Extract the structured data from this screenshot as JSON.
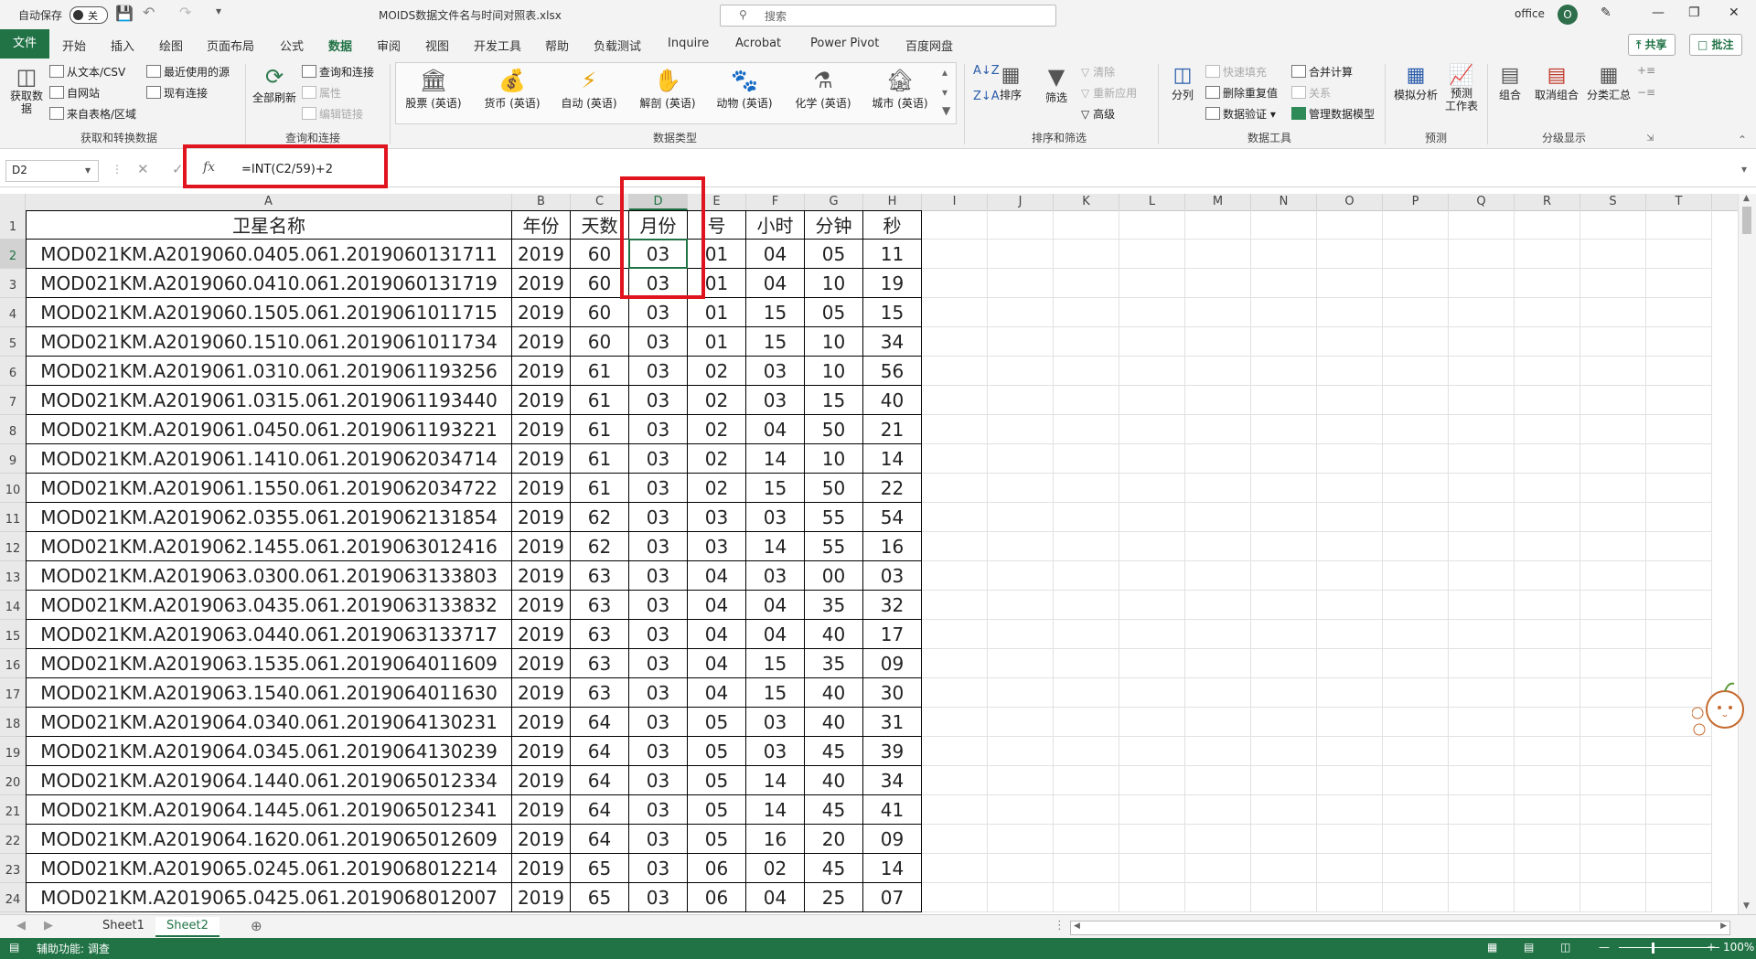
{
  "titlebar": {
    "autosave_label": "自动保存",
    "autosave_state": "关",
    "file_title": "MOIDS数据文件名与时间对照表.xlsx",
    "search_placeholder": "搜索",
    "user_name": "office",
    "avatar_initial": "O"
  },
  "tabs": [
    "文件",
    "开始",
    "插入",
    "绘图",
    "页面布局",
    "公式",
    "数据",
    "审阅",
    "视图",
    "开发工具",
    "帮助",
    "负载测试",
    "Inquire",
    "Acrobat",
    "Power Pivot",
    "百度网盘"
  ],
  "active_tab": "数据",
  "share_label": "共享",
  "comment_label": "批注",
  "ribbon": {
    "get_data": "获取数\n据",
    "from_text_csv": "从文本/CSV",
    "from_web": "自网站",
    "from_table": "来自表格/区域",
    "recent_sources": "最近使用的源",
    "existing_connections": "现有连接",
    "group_get_transform": "获取和转换数据",
    "refresh_all": "全部刷新",
    "queries_connections": "查询和连接",
    "properties": "属性",
    "edit_links": "编辑链接",
    "group_queries": "查询和连接",
    "data_types": [
      "股票 (英语)",
      "货币 (英语)",
      "自动 (英语)",
      "解剖 (英语)",
      "动物 (英语)",
      "化学 (英语)",
      "城市 (英语)"
    ],
    "group_data_types": "数据类型",
    "sort": "排序",
    "filter": "筛选",
    "clear": "清除",
    "reapply": "重新应用",
    "advanced": "高级",
    "group_sort_filter": "排序和筛选",
    "text_to_columns": "分列",
    "flash_fill": "快速填充",
    "remove_duplicates": "删除重复值",
    "data_validation": "数据验证",
    "consolidate": "合并计算",
    "relationships": "关系",
    "manage_model": "管理数据模型",
    "group_data_tools": "数据工具",
    "what_if": "模拟分析",
    "forecast_sheet": "预测\n工作表",
    "group_forecast": "预测",
    "group": "组合",
    "ungroup": "取消组合",
    "subtotal": "分类汇总",
    "group_outline": "分级显示"
  },
  "formula_bar": {
    "name_box": "D2",
    "formula": "=INT(C2/59)+2"
  },
  "columns": [
    "A",
    "B",
    "C",
    "D",
    "E",
    "F",
    "G",
    "H",
    "I",
    "J",
    "K",
    "L",
    "M",
    "N",
    "O",
    "P",
    "Q",
    "R",
    "S",
    "T"
  ],
  "selected_column": "D",
  "selected_row": "2",
  "headers": [
    "卫星名称",
    "年份",
    "天数",
    "月份",
    "号",
    "小时",
    "分钟",
    "秒"
  ],
  "rows": [
    [
      "MOD021KM.A2019060.0405.061.2019060131711",
      "2019",
      "60",
      "03",
      "01",
      "04",
      "05",
      "11"
    ],
    [
      "MOD021KM.A2019060.0410.061.2019060131719",
      "2019",
      "60",
      "03",
      "01",
      "04",
      "10",
      "19"
    ],
    [
      "MOD021KM.A2019060.1505.061.2019061011715",
      "2019",
      "60",
      "03",
      "01",
      "15",
      "05",
      "15"
    ],
    [
      "MOD021KM.A2019060.1510.061.2019061011734",
      "2019",
      "60",
      "03",
      "01",
      "15",
      "10",
      "34"
    ],
    [
      "MOD021KM.A2019061.0310.061.2019061193256",
      "2019",
      "61",
      "03",
      "02",
      "03",
      "10",
      "56"
    ],
    [
      "MOD021KM.A2019061.0315.061.2019061193440",
      "2019",
      "61",
      "03",
      "02",
      "03",
      "15",
      "40"
    ],
    [
      "MOD021KM.A2019061.0450.061.2019061193221",
      "2019",
      "61",
      "03",
      "02",
      "04",
      "50",
      "21"
    ],
    [
      "MOD021KM.A2019061.1410.061.2019062034714",
      "2019",
      "61",
      "03",
      "02",
      "14",
      "10",
      "14"
    ],
    [
      "MOD021KM.A2019061.1550.061.2019062034722",
      "2019",
      "61",
      "03",
      "02",
      "15",
      "50",
      "22"
    ],
    [
      "MOD021KM.A2019062.0355.061.2019062131854",
      "2019",
      "62",
      "03",
      "03",
      "03",
      "55",
      "54"
    ],
    [
      "MOD021KM.A2019062.1455.061.2019063012416",
      "2019",
      "62",
      "03",
      "03",
      "14",
      "55",
      "16"
    ],
    [
      "MOD021KM.A2019063.0300.061.2019063133803",
      "2019",
      "63",
      "03",
      "04",
      "03",
      "00",
      "03"
    ],
    [
      "MOD021KM.A2019063.0435.061.2019063133832",
      "2019",
      "63",
      "03",
      "04",
      "04",
      "35",
      "32"
    ],
    [
      "MOD021KM.A2019063.0440.061.2019063133717",
      "2019",
      "63",
      "03",
      "04",
      "04",
      "40",
      "17"
    ],
    [
      "MOD021KM.A2019063.1535.061.2019064011609",
      "2019",
      "63",
      "03",
      "04",
      "15",
      "35",
      "09"
    ],
    [
      "MOD021KM.A2019063.1540.061.2019064011630",
      "2019",
      "63",
      "03",
      "04",
      "15",
      "40",
      "30"
    ],
    [
      "MOD021KM.A2019064.0340.061.2019064130231",
      "2019",
      "64",
      "03",
      "05",
      "03",
      "40",
      "31"
    ],
    [
      "MOD021KM.A2019064.0345.061.2019064130239",
      "2019",
      "64",
      "03",
      "05",
      "03",
      "45",
      "39"
    ],
    [
      "MOD021KM.A2019064.1440.061.2019065012334",
      "2019",
      "64",
      "03",
      "05",
      "14",
      "40",
      "34"
    ],
    [
      "MOD021KM.A2019064.1445.061.2019065012341",
      "2019",
      "64",
      "03",
      "05",
      "14",
      "45",
      "41"
    ],
    [
      "MOD021KM.A2019064.1620.061.2019065012609",
      "2019",
      "64",
      "03",
      "05",
      "16",
      "20",
      "09"
    ],
    [
      "MOD021KM.A2019065.0245.061.2019068012214",
      "2019",
      "65",
      "03",
      "06",
      "02",
      "45",
      "14"
    ],
    [
      "MOD021KM.A2019065.0425.061.2019068012007",
      "2019",
      "65",
      "03",
      "06",
      "04",
      "25",
      "07"
    ]
  ],
  "sheets": [
    "Sheet1",
    "Sheet2"
  ],
  "active_sheet": "Sheet2",
  "status": {
    "accessibility": "辅助功能: 调查",
    "zoom": "100%"
  },
  "colors": {
    "accent": "#217346",
    "highlight": "#e0141e"
  }
}
